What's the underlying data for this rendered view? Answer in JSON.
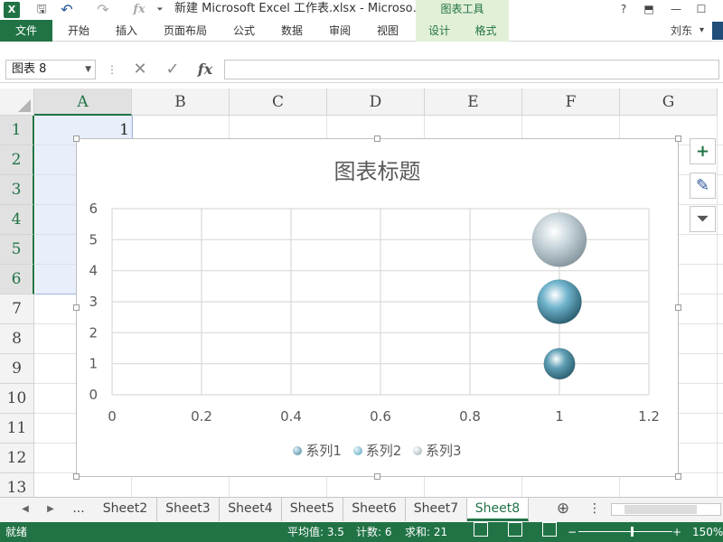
{
  "titlebar": {
    "title": "新建 Microsoft Excel 工作表.xlsx - Microso…",
    "chart_tools": "图表工具",
    "qa_excel": "X",
    "qa_save": "🖫",
    "qa_undo": "↶",
    "qa_redo": "↷",
    "qa_fx": "fx",
    "qa_more": "⏷",
    "help": "?",
    "ribbon_opts": "⬒",
    "minimize": "—",
    "maximize": "☐"
  },
  "tabs": {
    "file": "文件",
    "home": "开始",
    "insert": "插入",
    "layout": "页面布局",
    "formulas": "公式",
    "data": "数据",
    "review": "审阅",
    "view": "视图",
    "design": "设计",
    "format": "格式",
    "user": "刘东",
    "user_dd": "▾"
  },
  "formula": {
    "namebox": "图表 8",
    "namebox_dd": "▼",
    "sep": "⋮",
    "cancel": "✕",
    "enter": "✓",
    "fx": "fx",
    "value": ""
  },
  "grid": {
    "columns": [
      "A",
      "B",
      "C",
      "D",
      "E",
      "F",
      "G"
    ],
    "rows": [
      "1",
      "2",
      "3",
      "4",
      "5",
      "6",
      "7",
      "8",
      "9",
      "10",
      "11",
      "12",
      "13"
    ],
    "a1_value": "1"
  },
  "chart": {
    "title": "图表标题",
    "legend": [
      "系列1",
      "系列2",
      "系列3"
    ],
    "btn_add": "+",
    "btn_style": "✎",
    "btn_filter": "⏷"
  },
  "chart_data": {
    "type": "bubble",
    "title": "图表标题",
    "xlim": [
      0,
      1.2
    ],
    "ylim": [
      0,
      6
    ],
    "x_ticks": [
      0,
      0.2,
      0.4,
      0.6,
      0.8,
      1,
      1.2
    ],
    "y_ticks": [
      0,
      1,
      2,
      3,
      4,
      5,
      6
    ],
    "grid": true,
    "legend_position": "bottom",
    "series": [
      {
        "name": "系列1",
        "x": [
          1
        ],
        "y": [
          1
        ],
        "size": [
          1
        ],
        "color": "#5f9fb5"
      },
      {
        "name": "系列2",
        "x": [
          1
        ],
        "y": [
          3
        ],
        "size": [
          2
        ],
        "color": "#6fb3cc"
      },
      {
        "name": "系列3",
        "x": [
          1
        ],
        "y": [
          5
        ],
        "size": [
          3
        ],
        "color": "#c9d6dc"
      }
    ]
  },
  "sheets": {
    "nav_prev": "◀",
    "nav_next": "▶",
    "ellipsis": "...",
    "tabs": [
      "Sheet2",
      "Sheet3",
      "Sheet4",
      "Sheet5",
      "Sheet6",
      "Sheet7",
      "Sheet8"
    ],
    "active": "Sheet8",
    "add": "⊕",
    "more": "⋮"
  },
  "status": {
    "ready": "就绪",
    "average": "平均值: 3.5",
    "count": "计数: 6",
    "sum": "求和: 21",
    "zoom_minus": "−",
    "zoom_plus": "+",
    "zoom": "150%"
  },
  "colors": {
    "accent": "#217346",
    "context_tab": "#e2f0d9"
  }
}
